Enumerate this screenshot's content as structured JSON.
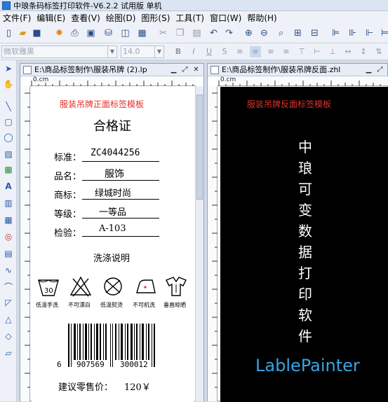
{
  "window": {
    "title": "中琅条码标签打印软件-V6.2.2 试用版 单机"
  },
  "menu": [
    "文件(F)",
    "编辑(E)",
    "查看(V)",
    "绘图(D)",
    "图形(S)",
    "工具(T)",
    "窗口(W)",
    "帮助(H)"
  ],
  "format_bar": {
    "font_name": "微软雅黑",
    "font_size": "14.0"
  },
  "doc_left": {
    "title": "E:\\商品标签制作\\服装吊牌 (2).lp",
    "ruler_label": "0.cm",
    "template_label": "服装吊牌正面标签模板",
    "heading": "合格证",
    "fields": [
      {
        "label": "标准：",
        "value": "ZC4044256"
      },
      {
        "label": "品名：",
        "value": "服饰"
      },
      {
        "label": "商标：",
        "value": "绿城时尚"
      },
      {
        "label": "等级：",
        "value": "一等品"
      },
      {
        "label": "检验：",
        "value": "A-103"
      }
    ],
    "wash_title": "洗涤说明",
    "care": [
      "低温手洗",
      "不可漂白",
      "低温熨烫",
      "不可机洗",
      "垂直晾晒"
    ],
    "care_icons": [
      "wash-30-icon",
      "no-bleach-icon",
      "low-iron-icon",
      "no-machine-wash-icon",
      "hang-dry-icon"
    ],
    "barcode_digits": {
      "first": "6",
      "left": "907569",
      "right": "300012"
    },
    "price_text": "建议零售价：",
    "price_value": "120￥"
  },
  "doc_right": {
    "title": "E:\\商品标签制作\\服装吊牌反面.zhl",
    "ruler_label": "0.cm",
    "template_label": "服装吊牌反面标签模板",
    "vertical_text": [
      "中",
      "琅",
      "可",
      "变",
      "数",
      "据",
      "打",
      "印",
      "软",
      "件"
    ],
    "brand": "LablePainter"
  },
  "colors": {
    "red_text": "#e0312c",
    "brand_blue": "#3aa3e0",
    "back_bg": "#000000"
  }
}
